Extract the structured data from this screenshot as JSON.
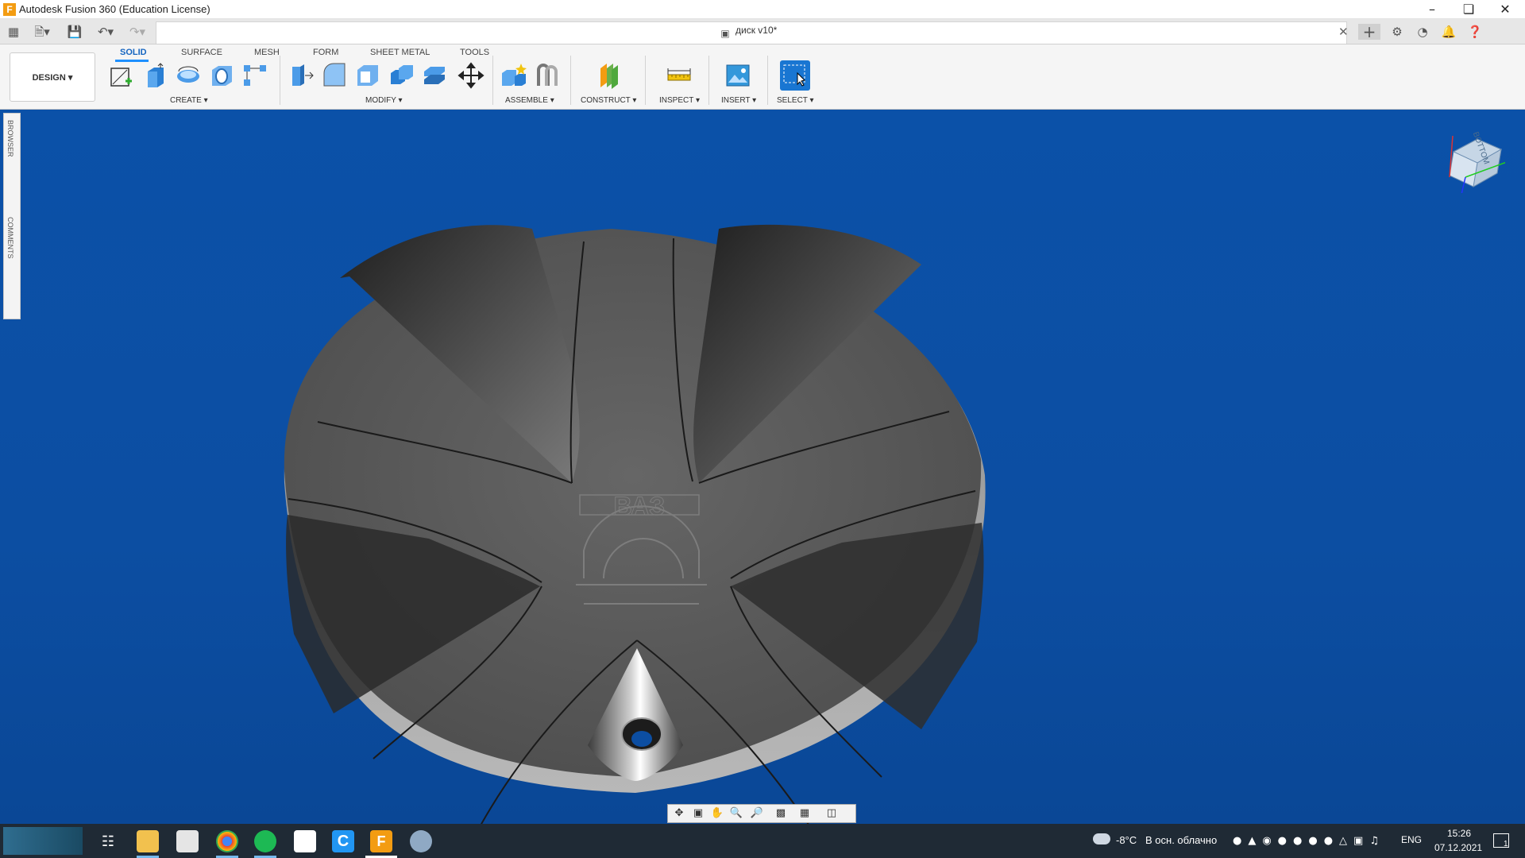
{
  "window": {
    "title": "Autodesk Fusion 360 (Education License)",
    "app_logo_letter": "F",
    "minimize_icon": "minimize-icon",
    "restore_icon": "restore-icon",
    "close_icon": "close-icon"
  },
  "document_tab": {
    "name": "диск v10*"
  },
  "ribbon": {
    "workspace_label": "DESIGN ▾",
    "tabs": [
      "SOLID",
      "SURFACE",
      "MESH",
      "FORM",
      "SHEET METAL",
      "TOOLS"
    ],
    "active_tab": "SOLID",
    "groups": [
      "CREATE ▾",
      "MODIFY ▾",
      "ASSEMBLE ▾",
      "CONSTRUCT ▾",
      "INSPECT ▾",
      "INSERT ▾",
      "SELECT ▾"
    ]
  },
  "side_panel": {
    "browser_label": "BROWSER",
    "comments_label": "COMMENTS"
  },
  "viewcube": {
    "face_label": "BOTTOM"
  },
  "model": {
    "emblem_text": "ВАЗ"
  },
  "colors": {
    "accent": "#1e90ff",
    "viewport_bg": "#0b51a8",
    "model_gray": "#5c5c5c"
  },
  "taskbar": {
    "weather_temp": "-8°C",
    "weather_text": "В осн. облачно",
    "language": "ENG",
    "time": "15:26",
    "date": "07.12.2021",
    "notifications_count": "1"
  }
}
